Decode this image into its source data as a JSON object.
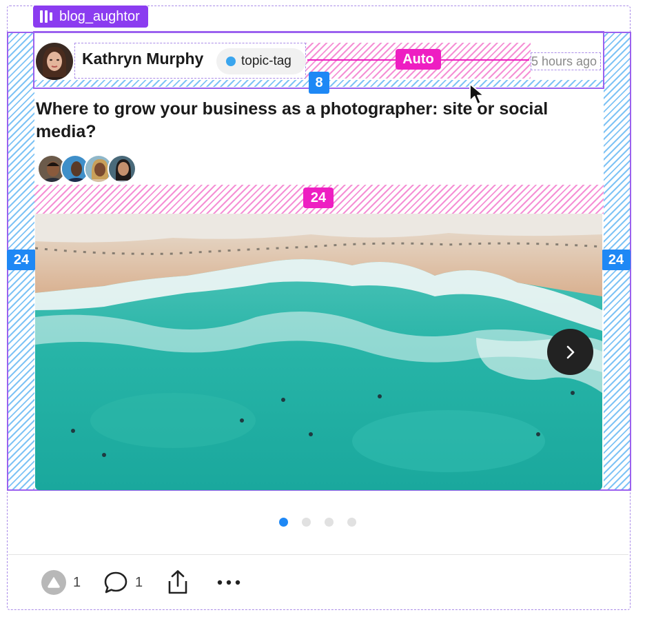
{
  "component": {
    "name": "blog_aughtor"
  },
  "spacing": {
    "header_gap": "8",
    "content_gap": "24",
    "padding_left": "24",
    "padding_right": "24",
    "auto_gap": "Auto"
  },
  "post": {
    "author": "Kathryn Murphy",
    "topic": "topic-tag",
    "timestamp": "5 hours ago",
    "title": "Where to grow your business as a photographer: site or social media?"
  },
  "carousel": {
    "total": 4,
    "active_index": 0
  },
  "actions": {
    "upvotes": "1",
    "comments": "1"
  },
  "colors": {
    "accent": "#8b3cf0",
    "spacing_blue": "#1e88f5",
    "spacing_pink": "#ee1ec2",
    "topic_dot": "#3aa5ee"
  }
}
